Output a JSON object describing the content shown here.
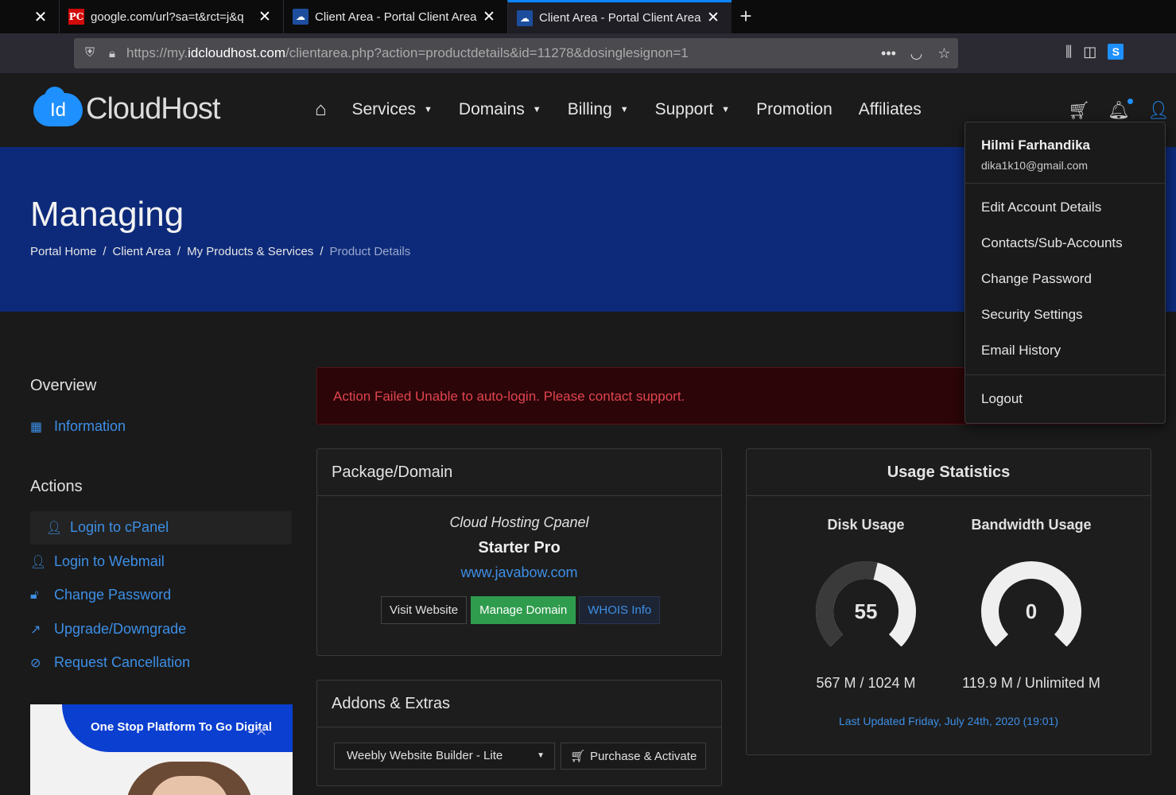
{
  "browser": {
    "tabs": [
      {
        "title": "google.com/url?sa=t&rct=j&q"
      },
      {
        "title": "Client Area - Portal Client Area"
      },
      {
        "title": "Client Area - Portal Client Area"
      }
    ],
    "favicons": {
      "pc": "PC"
    },
    "url_host": "https://my.",
    "url_domain": "idcloudhost.com",
    "url_path": "/clientarea.php?action=productdetails&id=11278&dosinglesignon=1",
    "s_icon_label": "S"
  },
  "header": {
    "logo_badge": "Id",
    "logo_text": "CloudHost",
    "nav": [
      "Services",
      "Domains",
      "Billing",
      "Support",
      "Promotion",
      "Affiliates"
    ]
  },
  "banner": {
    "title": "Managing",
    "breadcrumbs": [
      "Portal Home",
      "Client Area",
      "My Products & Services",
      "Product Details"
    ],
    "bg_color": "#0d2a7a"
  },
  "sidebar": {
    "overview_heading": "Overview",
    "information": "Information",
    "actions_heading": "Actions",
    "actions": [
      "Login to cPanel",
      "Login to Webmail",
      "Change Password",
      "Upgrade/Downgrade",
      "Request Cancellation"
    ],
    "promo_text": "One Stop Platform To Go Digital"
  },
  "alert": {
    "text": "Action Failed Unable to auto-login. Please contact support."
  },
  "package_panel": {
    "heading": "Package/Domain",
    "group": "Cloud Hosting Cpanel",
    "product": "Starter Pro",
    "domain": "www.javabow.com",
    "buttons": [
      "Visit Website",
      "Manage Domain",
      "WHOIS Info"
    ]
  },
  "usage_panel": {
    "heading": "Usage Statistics",
    "disk": {
      "title": "Disk Usage",
      "value": "55",
      "percent": 55,
      "detail": "567 M / 1024 M"
    },
    "bandwidth": {
      "title": "Bandwidth Usage",
      "value": "0",
      "percent": 0,
      "detail": "119.9 M / Unlimited M"
    },
    "updated": "Last Updated Friday, July 24th, 2020 (19:01)"
  },
  "addons_panel": {
    "heading": "Addons & Extras",
    "selected_addon": "Weebly Website Builder - Lite",
    "purchase_label": "Purchase & Activate"
  },
  "user_menu": {
    "name": "Hilmi Farhandika",
    "email": "dika1k10@gmail.com",
    "items": [
      "Edit Account Details",
      "Contacts/Sub-Accounts",
      "Change Password",
      "Security Settings",
      "Email History"
    ],
    "logout": "Logout"
  },
  "colors": {
    "accent": "#3d8fe6",
    "success": "#2f9c4d",
    "danger": "#e0444f"
  }
}
